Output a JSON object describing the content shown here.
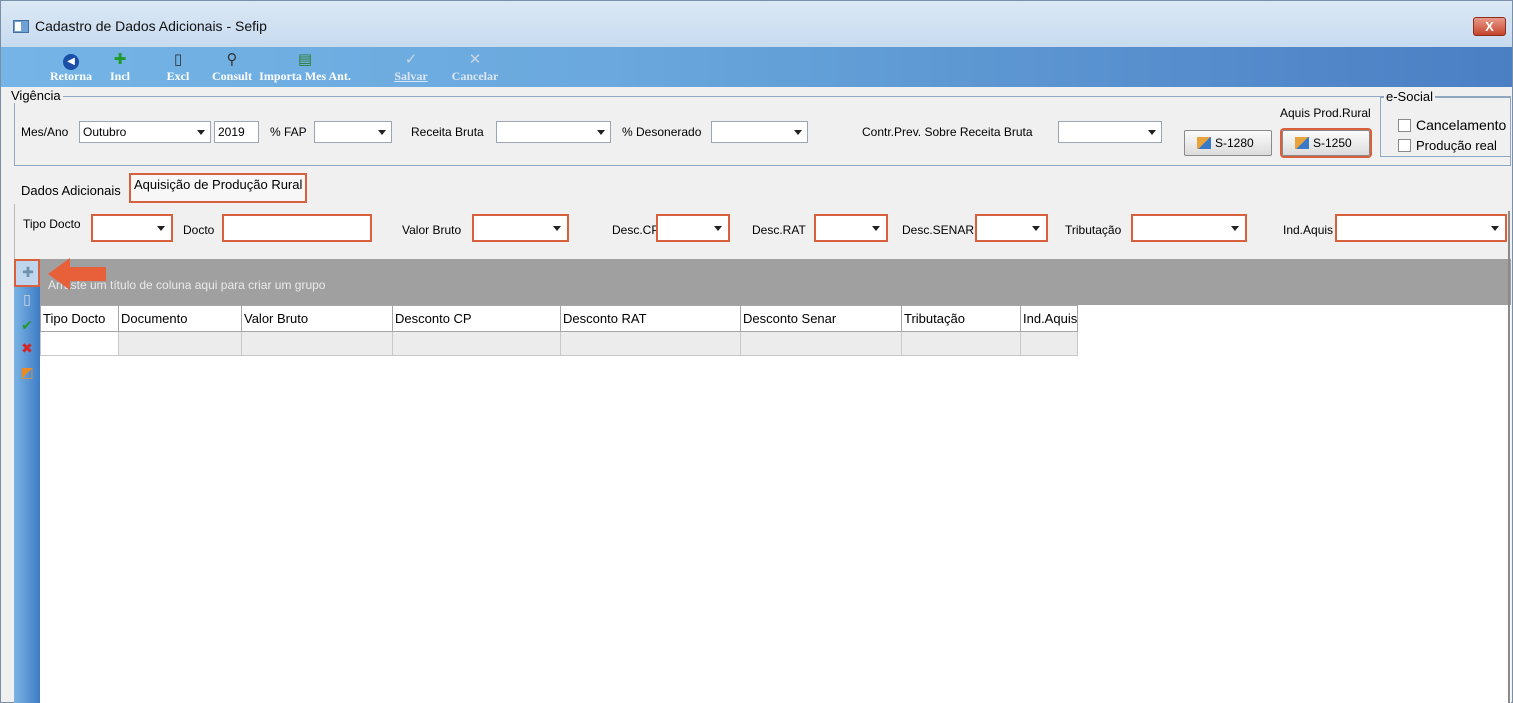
{
  "window": {
    "title": "Cadastro de Dados Adicionais - Sefip",
    "close_label": "X"
  },
  "toolbar": [
    {
      "id": "retorna",
      "label": "Retorna",
      "icon": "back-icon",
      "glyph": "◀",
      "color": "#1b4fa8"
    },
    {
      "id": "incl",
      "label": "Incl",
      "icon": "add-icon",
      "glyph": "+",
      "color": "#1f9a2b"
    },
    {
      "id": "excl",
      "label": "Excl",
      "icon": "delete-icon",
      "glyph": "▯",
      "color": "#333"
    },
    {
      "id": "consult",
      "label": "Consult",
      "icon": "search-icon",
      "glyph": "⚲",
      "color": "#333"
    },
    {
      "id": "importa",
      "label": "Importa Mes Ant.",
      "icon": "import-icon",
      "glyph": "▤",
      "color": "#2f7d2f"
    },
    {
      "id": "salvar",
      "label": "Salvar",
      "icon": "check-icon",
      "glyph": "✓",
      "color": "#c9d6e4"
    },
    {
      "id": "cancelar",
      "label": "Cancelar",
      "icon": "cancel-icon",
      "glyph": "✕",
      "color": "#c9d6e4"
    }
  ],
  "vigencia": {
    "legend": "Vigência",
    "mes_ano_label": "Mes/Ano",
    "mes_value": "Outubro",
    "ano_value": "2019",
    "fap_label": "% FAP",
    "fap_value": "",
    "receita_label": "Receita Bruta",
    "receita_value": "",
    "desonerado_label": "% Desonerado",
    "desonerado_value": "",
    "contr_label": "Contr.Prev. Sobre Receita Bruta",
    "contr_value": "",
    "aquis_label": "Aquis Prod.Rural",
    "btn_s1280": "S-1280",
    "btn_s1250": "S-1250"
  },
  "esocial": {
    "legend": "e-Social",
    "cancelamento": "Cancelamento",
    "producao_real": "Produção real"
  },
  "tabs": [
    "Dados Adicionais",
    "Aquisição de Produção Rural"
  ],
  "filter": {
    "tipo_docto": "Tipo Docto",
    "docto": "Docto",
    "valor_bruto": "Valor Bruto",
    "desc_cp": "Desc.CP",
    "desc_rat": "Desc.RAT",
    "desc_senar": "Desc.SENAR",
    "tributacao": "Tributação",
    "ind_aquis": "Ind.Aquis"
  },
  "group_hint": "Arraste um título de coluna aqui para criar um grupo",
  "grid": {
    "columns": [
      "Tipo Docto",
      "Documento",
      "Valor Bruto",
      "Desconto CP",
      "Desconto RAT",
      "Desconto Senar",
      "Tributação",
      "Ind.Aquis"
    ]
  }
}
